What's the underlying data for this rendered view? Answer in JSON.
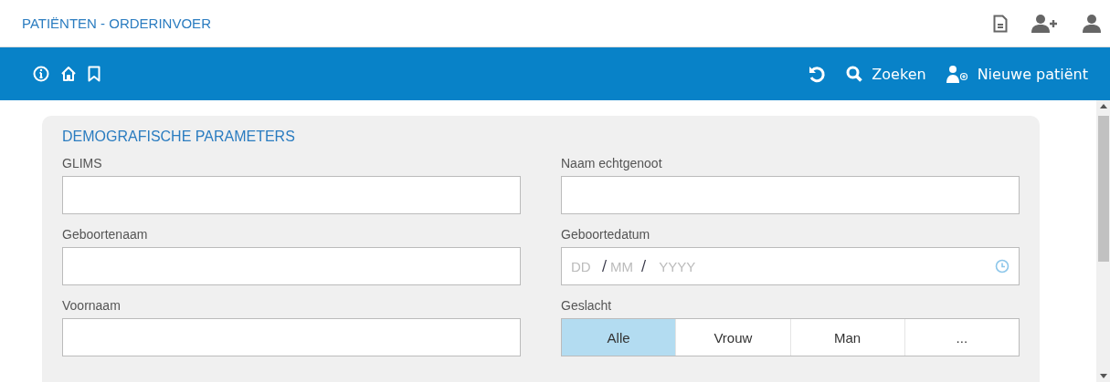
{
  "header": {
    "title": "PATIËNTEN - ORDERINVOER"
  },
  "toolbar": {
    "actions": [
      {
        "kind": "reset"
      },
      {
        "kind": "search",
        "label": "Zoeken"
      },
      {
        "kind": "new-patient",
        "label": "Nieuwe patiënt"
      }
    ]
  },
  "section": {
    "title": "DEMOGRAFISCHE PARAMETERS",
    "left_fields": [
      {
        "label": "GLIMS"
      },
      {
        "label": "Geboortenaam"
      },
      {
        "label": "Voornaam"
      }
    ],
    "right_fields": [
      {
        "kind": "text",
        "label": "Naam echtgenoot"
      },
      {
        "kind": "date",
        "label": "Geboortedatum",
        "parts": [
          {
            "placeholder": "DD"
          },
          {
            "placeholder": "MM"
          },
          {
            "placeholder": "YYYY"
          }
        ],
        "separators": [
          "/",
          "/"
        ]
      },
      {
        "kind": "segmented",
        "label": "Geslacht",
        "options": [
          {
            "label": "Alle",
            "selected": true
          },
          {
            "label": "Vrouw",
            "selected": false
          },
          {
            "label": "Man",
            "selected": false
          },
          {
            "label": "...",
            "selected": false
          }
        ]
      }
    ]
  }
}
